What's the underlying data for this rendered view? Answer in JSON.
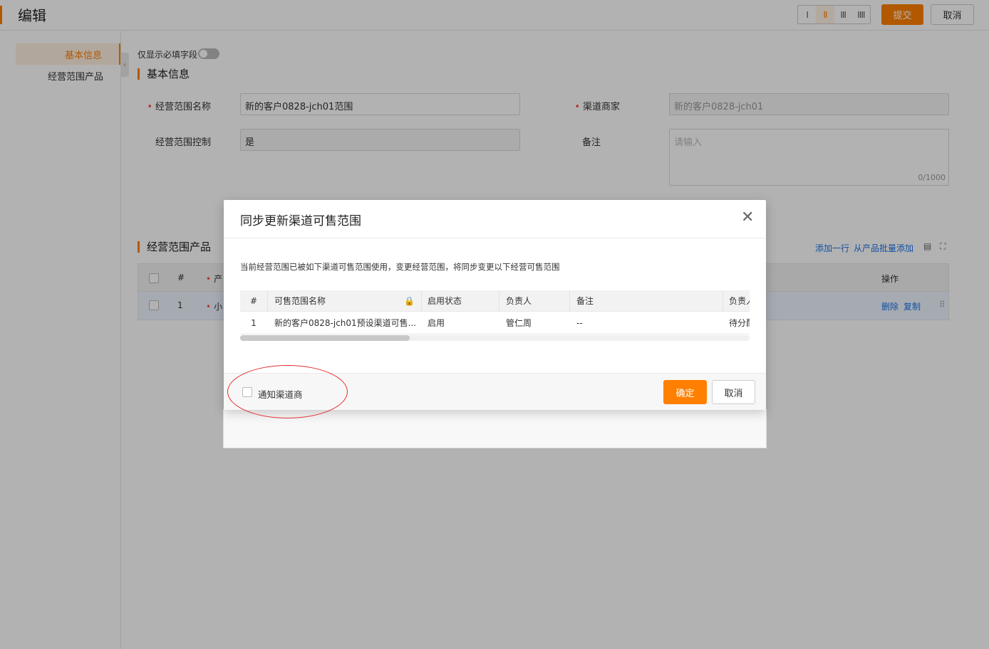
{
  "header": {
    "title": "编辑",
    "layout_options": [
      "I",
      "II",
      "III",
      "IIII"
    ],
    "active_layout": 1,
    "submit_label": "提交",
    "cancel_label": "取消"
  },
  "sidenav": {
    "items": [
      {
        "label": "基本信息",
        "active": true
      },
      {
        "label": "经营范围产品",
        "active": false
      }
    ]
  },
  "form": {
    "required_only_label": "仅显示必填字段",
    "basic_section_title": "基本信息",
    "fields": {
      "scope_name_label": "经营范围名称",
      "scope_name_value": "新的客户0828-jch01范围",
      "channel_dealer_label": "渠道商家",
      "channel_dealer_value": "新的客户0828-jch01",
      "scope_control_label": "经营范围控制",
      "scope_control_value": "是",
      "remark_label": "备注",
      "remark_placeholder": "请输入",
      "remark_counter": "0/1000"
    }
  },
  "products": {
    "section_title": "经营范围产品",
    "add_row_label": "添加一行",
    "batch_add_label": "从产品批量添加",
    "head": {
      "index": "#",
      "product_prefix": "产",
      "ops": "操作"
    },
    "row": {
      "index": "1",
      "product_prefix": "小",
      "delete": "删除",
      "copy": "复制"
    }
  },
  "modal": {
    "title": "同步更新渠道可售范围",
    "description": "当前经营范围已被如下渠道可售范围使用，变更经营范围，将同步变更以下经营可售范围",
    "columns": [
      "#",
      "可售范围名称",
      "启用状态",
      "负责人",
      "备注",
      "负责人"
    ],
    "rows": [
      {
        "index": "1",
        "name": "新的客户0828-jch01预设渠道可售...",
        "status": "启用",
        "owner": "管仁周",
        "remark": "--",
        "extra": "待分配"
      }
    ],
    "notify_label": "通知渠道商",
    "confirm_label": "确定",
    "cancel_label": "取消"
  },
  "colors": {
    "accent": "#ff8000",
    "link": "#1a73e8",
    "annotation": "#e03030"
  }
}
